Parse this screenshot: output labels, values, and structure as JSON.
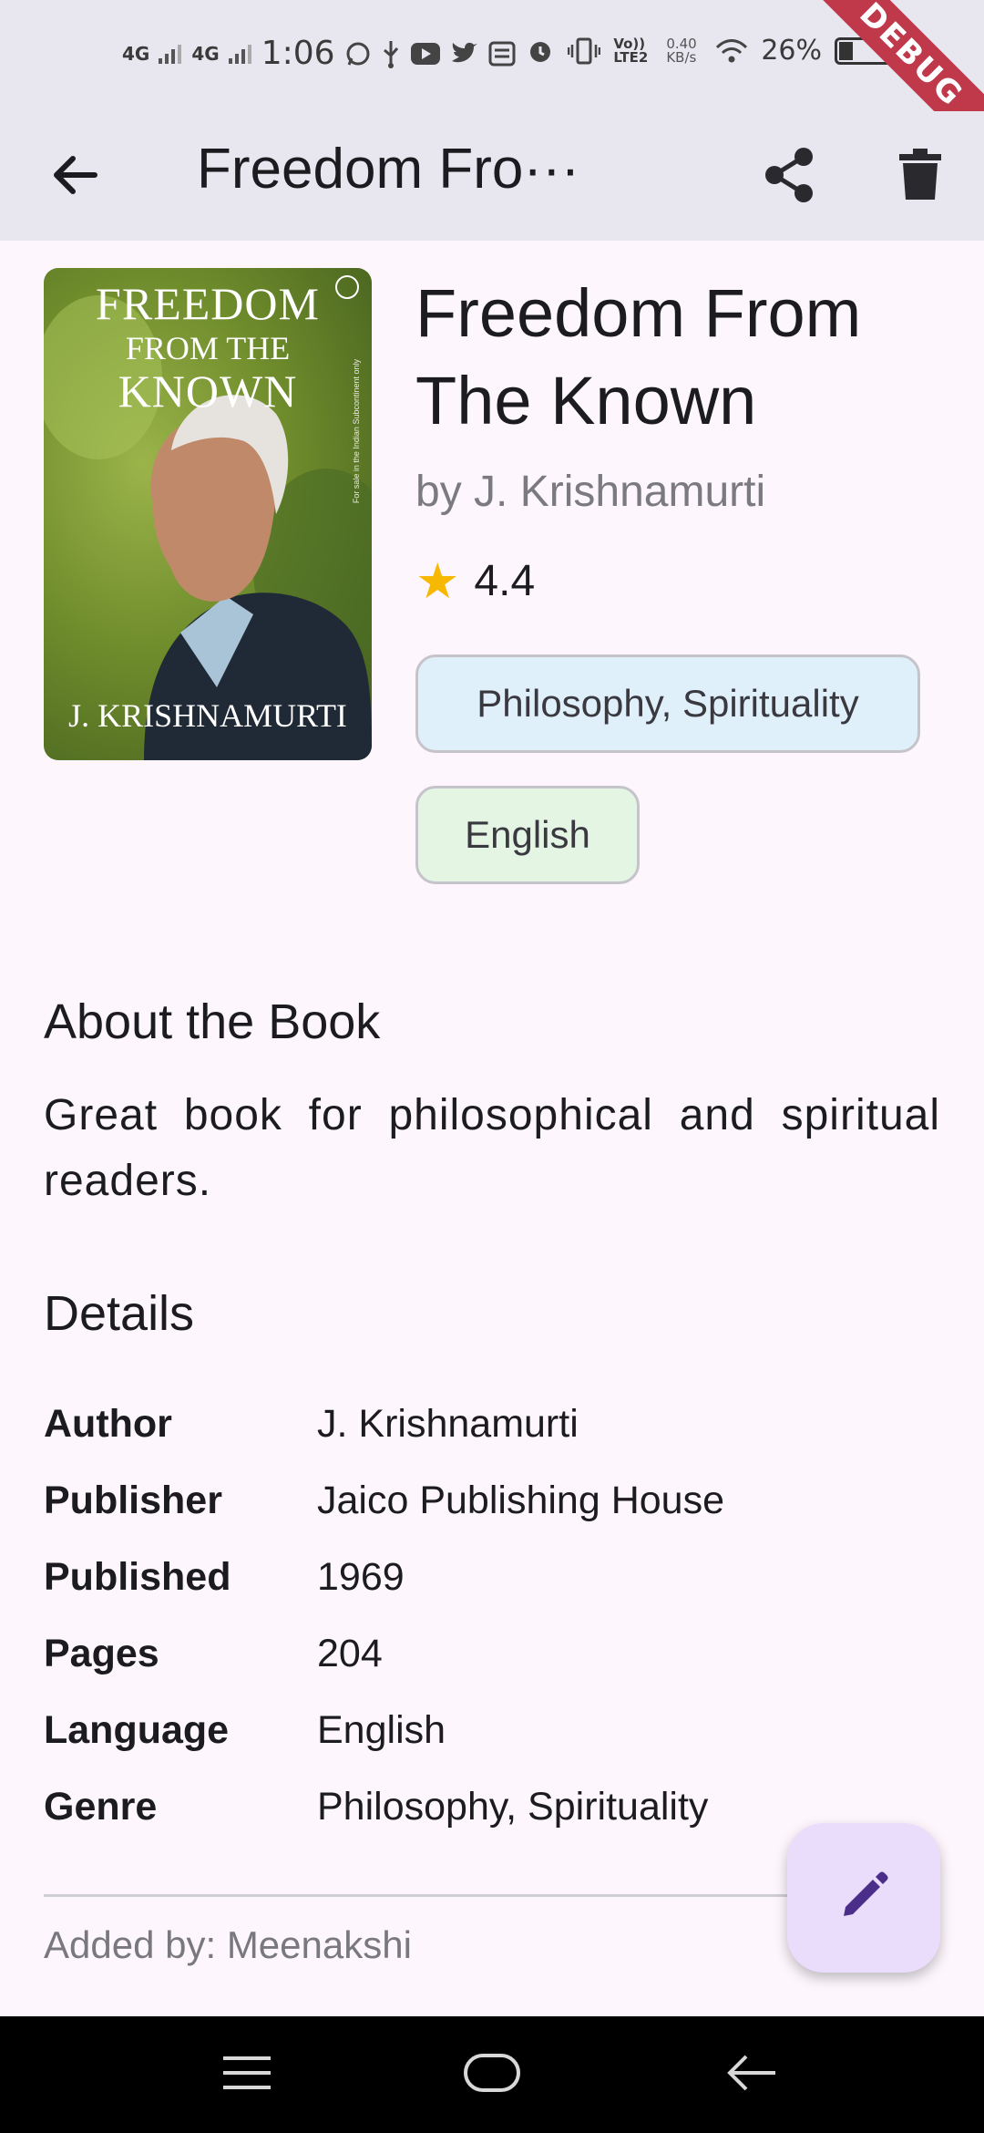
{
  "status_bar": {
    "net1": "4G",
    "net2": "4G",
    "time": "1:06",
    "volte": "Vo)) LTE2",
    "speed": "0.40 KB/s",
    "battery_text": "26%",
    "debug_label": "DEBUG"
  },
  "app_bar": {
    "title": "Freedom Fro···",
    "back_icon": "arrow-back-icon",
    "share_icon": "share-icon",
    "delete_icon": "delete-icon"
  },
  "book": {
    "cover": {
      "title_line1": "FREEDOM",
      "title_line2": "FROM THE",
      "title_line3": "KNOWN",
      "author": "J. KRISHNAMURTI",
      "side_text": "For sale in the Indian Subcontinent only"
    },
    "title": "Freedom From The Known",
    "author_line": "by J. Krishnamurti",
    "rating": "4.4",
    "genre_chip": "Philosophy, Spirituality",
    "language_chip": "English"
  },
  "about": {
    "heading": "About the Book",
    "text": "Great book for philosophical and spiritual readers."
  },
  "details": {
    "heading": "Details",
    "rows": [
      {
        "label": "Author",
        "value": "J. Krishnamurti"
      },
      {
        "label": "Publisher",
        "value": "Jaico Publishing House"
      },
      {
        "label": "Published",
        "value": "1969"
      },
      {
        "label": "Pages",
        "value": "204"
      },
      {
        "label": "Language",
        "value": "English"
      },
      {
        "label": "Genre",
        "value": "Philosophy, Spirituality"
      }
    ]
  },
  "added_by": "Added by: Meenakshi",
  "fab_icon": "edit-icon",
  "colors": {
    "background": "#fdf7fd",
    "app_bar": "#e8e6ef",
    "genre_chip": "#e0f0fb",
    "language_chip": "#e4f5e4",
    "fab": "#eadcfb",
    "fab_icon": "#4a2e8a",
    "star": "#f7b801",
    "debug_banner": "#c0394b"
  }
}
